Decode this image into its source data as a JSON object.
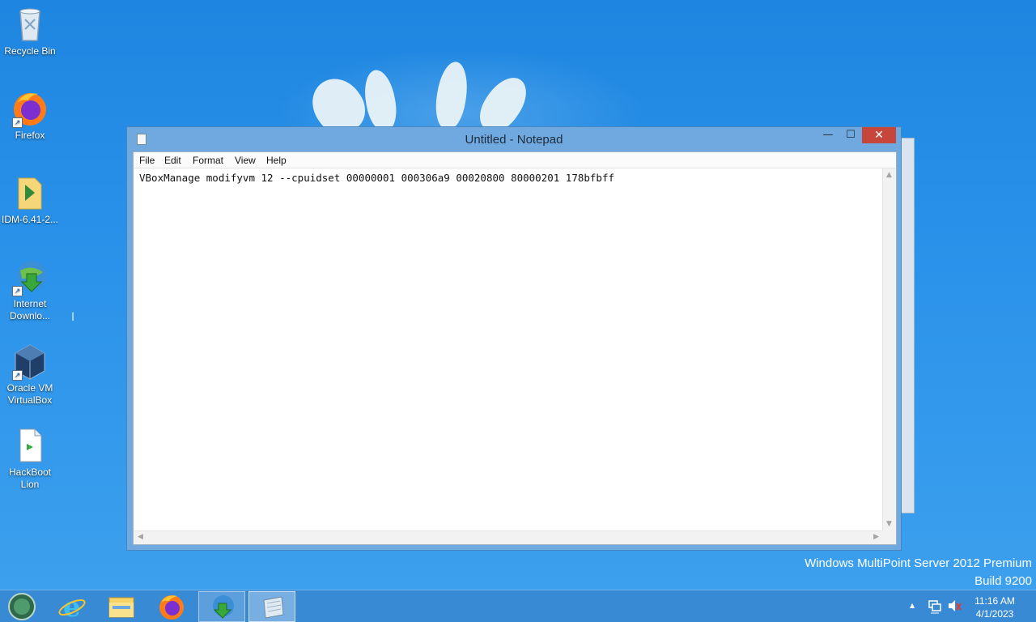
{
  "desktop_icons": [
    {
      "label_line1": "Recycle Bin",
      "label_line2": ""
    },
    {
      "label_line1": "Firefox",
      "label_line2": ""
    },
    {
      "label_line1": "IDM-6.41-2...",
      "label_line2": ""
    },
    {
      "label_line1": "Internet",
      "label_line2": "Downlo..."
    },
    {
      "label_line1": "Oracle VM",
      "label_line2": "VirtualBox"
    },
    {
      "label_line1": "HackBoot",
      "label_line2": "Lion"
    }
  ],
  "window": {
    "title": "Untitled - Notepad",
    "minimize_glyph": "—",
    "maximize_glyph": "☐",
    "close_glyph": "✕"
  },
  "menu": {
    "file": "File",
    "edit": "Edit",
    "format": "Format",
    "view": "View",
    "help": "Help"
  },
  "editor": {
    "content": "VBoxManage modifyvm 12 --cpuidset 00000001 000306a9 00020800 80000201 178bfbff"
  },
  "watermark": {
    "line1": "Windows MultiPoint Server 2012 Premium",
    "line2": "Build 9200"
  },
  "taskbar": {
    "buttons": [
      "start",
      "internet-explorer",
      "file-explorer",
      "firefox",
      "internet-download-manager",
      "notepad"
    ]
  },
  "tray": {
    "time": "11:16 AM",
    "date": "4/1/2023",
    "overflow_glyph": "▲"
  },
  "colors": {
    "accent": "#2b93ea",
    "close_button": "#c7463b",
    "window_frame": "#6fa9e0"
  }
}
